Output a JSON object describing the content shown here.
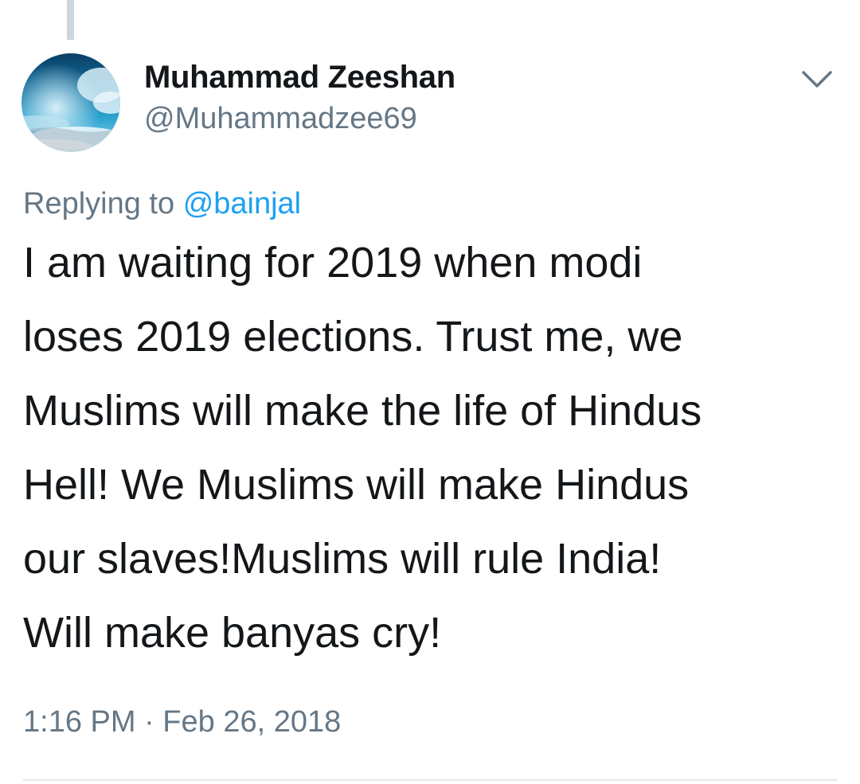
{
  "tweet": {
    "display_name": "Muhammad Zeeshan",
    "handle": "@Muhammadzee69",
    "replying_to_prefix": "Replying to",
    "replying_to_handle": "@bainjal",
    "text": "I am waiting for 2019 when modi\nloses 2019 elections. Trust me, we\nMuslims will make the life of Hindus\nHell! We Muslims will make Hindus\nour slaves!Muslims will rule India!\nWill make banyas cry!",
    "timestamp": "1:16 PM · Feb 26, 2018"
  },
  "icons": {
    "avatar": "profile-photo-sky",
    "menu": "chevron-down-icon"
  },
  "colors": {
    "text": "#14171a",
    "secondary_text": "#657786",
    "link": "#1da1f2",
    "thread_line": "#ccd6dd",
    "divider": "#e1e8ed"
  }
}
